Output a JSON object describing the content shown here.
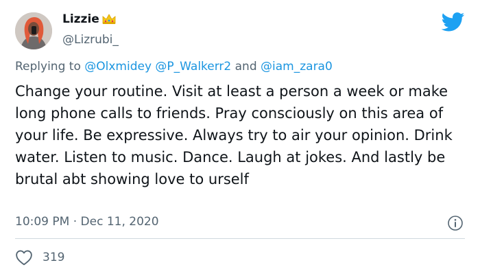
{
  "author": {
    "display_name": "Lizzie",
    "handle": "@Lizrubi_"
  },
  "reply": {
    "prefix": "Replying to",
    "mention_1": "@Olxmidey",
    "mention_2": "@P_Walkerr2",
    "conjunction": "and",
    "mention_3": "@iam_zara0"
  },
  "tweet": {
    "text": "Change your routine. Visit at least a person a week or make long phone calls to friends. Pray consciously on this area of your life. Be expressive. Always try to air your opinion. Drink water. Listen to music. Dance. Laugh at jokes. And lastly be brutal abt showing love to urself",
    "time": "10:09 PM",
    "separator": "·",
    "date": "Dec 11, 2020"
  },
  "stats": {
    "likes": "319"
  },
  "icons": {
    "brand": "twitter-bird-icon",
    "info": "info-icon",
    "like": "heart-icon",
    "name_emoji": "crown-emoji"
  },
  "colors": {
    "twitter_blue": "#1da1f2",
    "mention_blue": "#1b95e0",
    "secondary_text": "#536471",
    "primary_text": "#0f1419"
  }
}
